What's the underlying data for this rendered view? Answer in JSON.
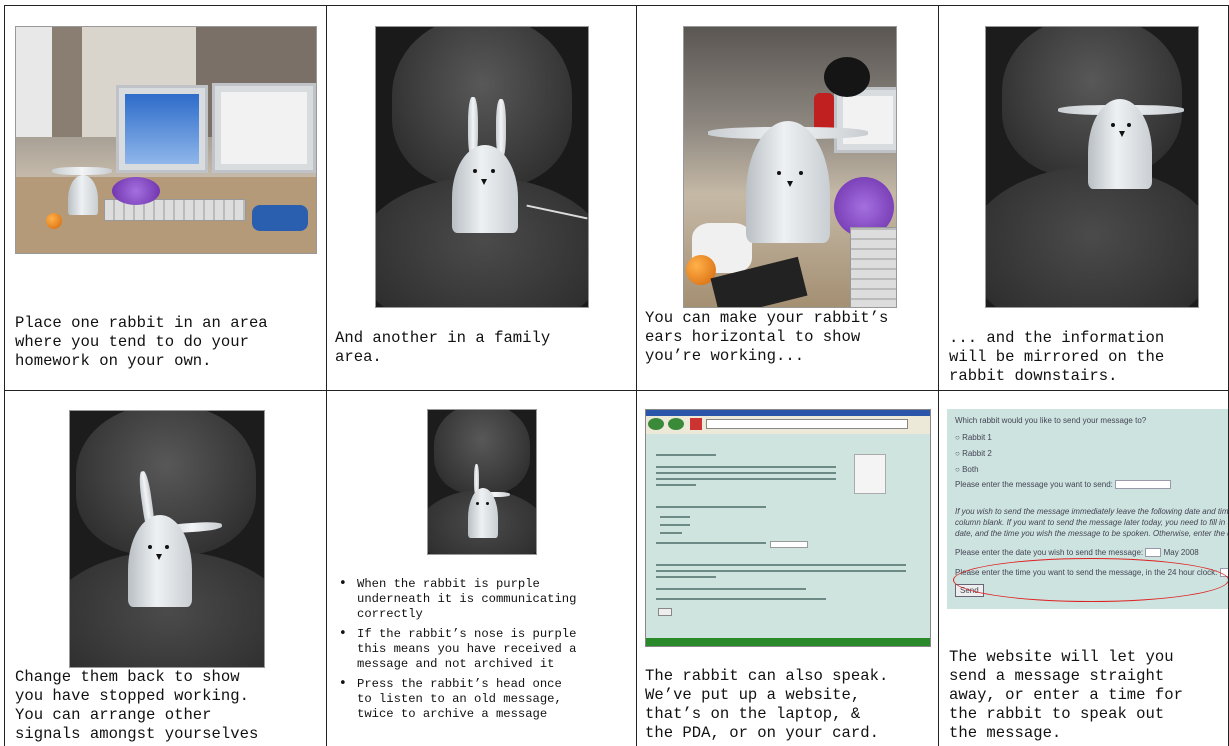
{
  "cells": {
    "c1": {
      "caption": "Place one rabbit in an area\nwhere you tend to do your\nhomework on your own."
    },
    "c2": {
      "caption": "And another in a family\narea."
    },
    "c3": {
      "caption": "You can make your rabbit’s\nears horizontal to show\nyou’re working..."
    },
    "c4": {
      "caption": "... and the information\nwill be mirrored on the\nrabbit downstairs."
    },
    "c5": {
      "caption": "Change them back to show\nyou have stopped working.\nYou can arrange other\nsignals amongst yourselves"
    },
    "c6": {
      "bullets": [
        "When the rabbit is purple\nunderneath it is communicating\ncorrectly",
        "If the rabbit’s nose is purple\nthis means you have received a\nmessage and not archived it",
        "Press the rabbit’s head once\nto listen to an old message,\ntwice to archive a message"
      ]
    },
    "c7": {
      "caption": "The rabbit can also speak.\nWe’ve put up a website,\nthat’s on the laptop, &\nthe PDA, or on your card."
    },
    "c8": {
      "caption": "The website will let you\nsend a message straight\naway, or enter a time for\nthe rabbit to speak out\nthe message.",
      "form": {
        "question": "Which rabbit would you like to send your message to?",
        "options": [
          "Rabbit 1",
          "Rabbit 2",
          "Both"
        ],
        "msg_label": "Please enter the message you want to send:",
        "italic_note": "If you wish to send the message immediately leave the following date and time column blank. If you want to send the message later today, you need to fill in today’s date, and the time you wish the message to be spoken. Otherwise, enter the date and other time.",
        "date_label": "Please enter the date you wish to send the message:",
        "date_suffix": "May 2008",
        "time_label": "Please enter the time you want to send the message, in the 24 hour clock:",
        "send": "Send"
      }
    }
  },
  "colors": {
    "grid": "#222222",
    "annotation_oval": "#dd2222",
    "web_bg": "#cfe3df"
  }
}
